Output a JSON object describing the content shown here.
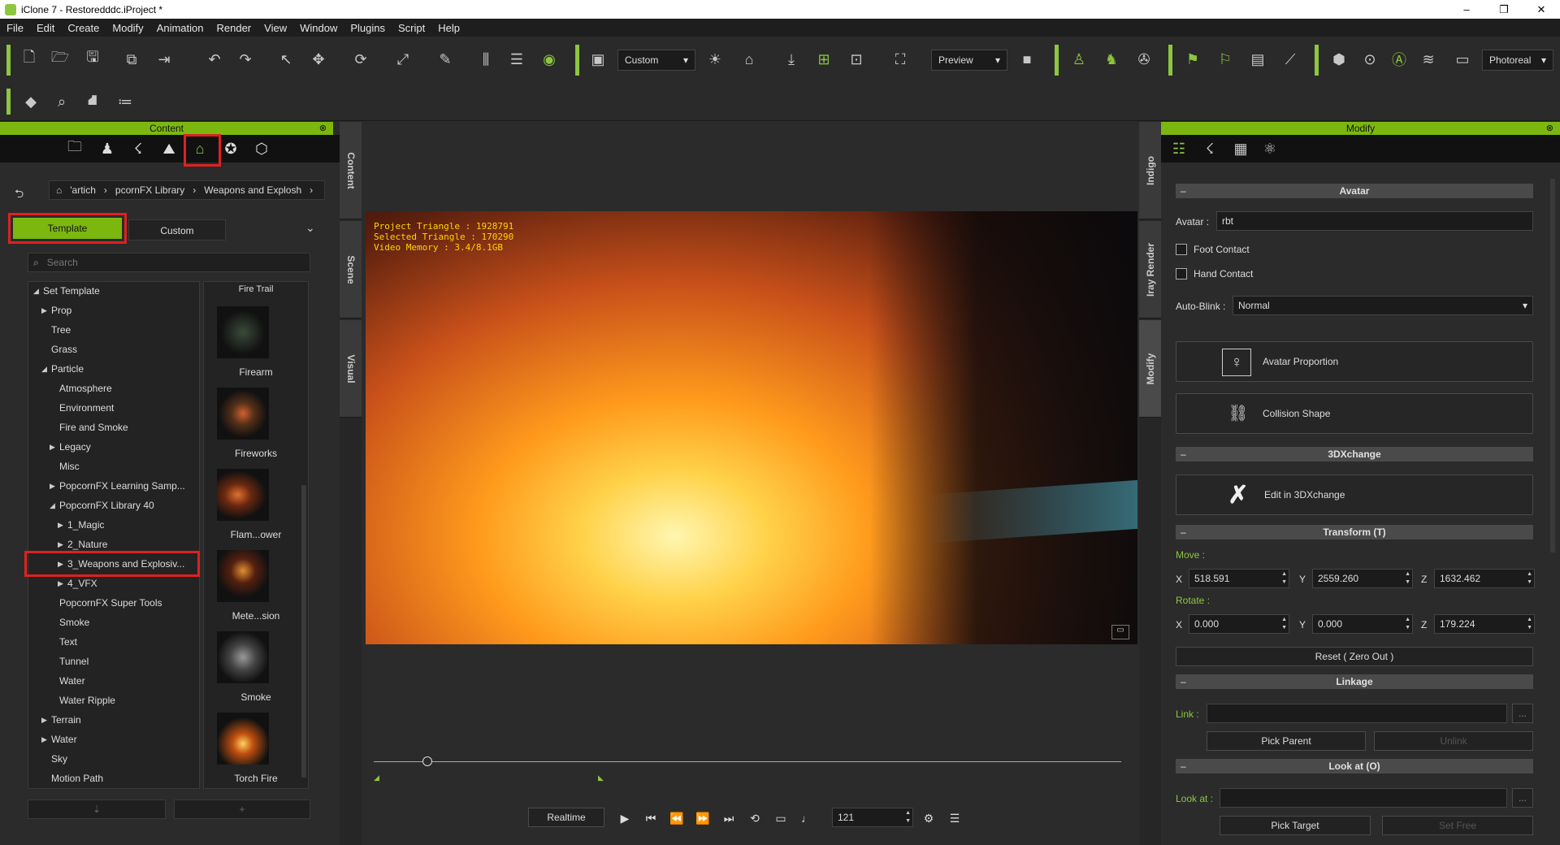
{
  "window": {
    "title": "iClone 7 - Restoredddc.iProject *",
    "minimize": "–",
    "maximize": "❐",
    "close": "✕"
  },
  "menu": [
    "File",
    "Edit",
    "Create",
    "Modify",
    "Animation",
    "Render",
    "View",
    "Window",
    "Plugins",
    "Script",
    "Help"
  ],
  "toolbar": {
    "custom_dropdown": "Custom",
    "preview_dropdown": "Preview",
    "render_dropdown": "Photoreal"
  },
  "content_panel": {
    "title": "Content",
    "breadcrumb": [
      "'artich",
      "pcornFX Library",
      "Weapons and Explosh"
    ],
    "tabs": {
      "template": "Template",
      "custom": "Custom"
    },
    "search_placeholder": "Search",
    "tree": [
      {
        "label": "Set Template",
        "indent": 0,
        "arrow": "down"
      },
      {
        "label": "Prop",
        "indent": 1,
        "arrow": "right"
      },
      {
        "label": "Tree",
        "indent": 1,
        "arrow": ""
      },
      {
        "label": "Grass",
        "indent": 1,
        "arrow": ""
      },
      {
        "label": "Particle",
        "indent": 1,
        "arrow": "down"
      },
      {
        "label": "Atmosphere",
        "indent": 2,
        "arrow": ""
      },
      {
        "label": "Environment",
        "indent": 2,
        "arrow": ""
      },
      {
        "label": "Fire and Smoke",
        "indent": 2,
        "arrow": ""
      },
      {
        "label": "Legacy",
        "indent": 2,
        "arrow": "right"
      },
      {
        "label": "Misc",
        "indent": 2,
        "arrow": ""
      },
      {
        "label": "PopcornFX Learning Samp...",
        "indent": 2,
        "arrow": "right"
      },
      {
        "label": "PopcornFX Library 40",
        "indent": 2,
        "arrow": "down"
      },
      {
        "label": "1_Magic",
        "indent": 3,
        "arrow": "right"
      },
      {
        "label": "2_Nature",
        "indent": 3,
        "arrow": "right"
      },
      {
        "label": "3_Weapons and Explosiv...",
        "indent": 3,
        "arrow": "right"
      },
      {
        "label": "4_VFX",
        "indent": 3,
        "arrow": "right"
      },
      {
        "label": "PopcornFX Super Tools",
        "indent": 2,
        "arrow": ""
      },
      {
        "label": "Smoke",
        "indent": 2,
        "arrow": ""
      },
      {
        "label": "Text",
        "indent": 2,
        "arrow": ""
      },
      {
        "label": "Tunnel",
        "indent": 2,
        "arrow": ""
      },
      {
        "label": "Water",
        "indent": 2,
        "arrow": ""
      },
      {
        "label": "Water Ripple",
        "indent": 2,
        "arrow": ""
      },
      {
        "label": "Terrain",
        "indent": 1,
        "arrow": "right"
      },
      {
        "label": "Water",
        "indent": 1,
        "arrow": "right"
      },
      {
        "label": "Sky",
        "indent": 1,
        "arrow": ""
      },
      {
        "label": "Motion Path",
        "indent": 1,
        "arrow": ""
      }
    ],
    "top_cut_label": "Fire Trail",
    "thumbnails": [
      "Firearm",
      "Fireworks",
      "Flam...ower",
      "Mete...sion",
      "Smoke",
      "Torch Fire"
    ],
    "bottom_buttons": {
      "down": "⇣",
      "add": "+"
    }
  },
  "side_tabs_left": [
    "Content",
    "Scene",
    "Visual"
  ],
  "side_tabs_right": [
    "Indigo",
    "Iray Render",
    "Modify"
  ],
  "viewport": {
    "stat_line1": "Project Triangle : 1928791",
    "stat_line2": "Selected Triangle : 170290",
    "stat_line3": "Video Memory : 3.4/8.1GB"
  },
  "playback": {
    "mode": "Realtime",
    "frame": "121"
  },
  "modify_panel": {
    "title": "Modify",
    "avatar_section": "Avatar",
    "avatar_label": "Avatar :",
    "avatar_value": "rbt",
    "foot_contact": "Foot Contact",
    "hand_contact": "Hand Contact",
    "auto_blink_label": "Auto-Blink :",
    "auto_blink_value": "Normal",
    "avatar_proportion": "Avatar Proportion",
    "collision_shape": "Collision Shape",
    "xchange_section": "3DXchange",
    "edit_3dx": "Edit in 3DXchange",
    "transform_section": "Transform  (T)",
    "move_label": "Move :",
    "rotate_label": "Rotate :",
    "move": {
      "x": "518.591",
      "y": "2559.260",
      "z": "1632.462"
    },
    "rotate": {
      "x": "0.000",
      "y": "0.000",
      "z": "179.224"
    },
    "axis_x": "X",
    "axis_y": "Y",
    "axis_z": "Z",
    "reset": "Reset ( Zero Out )",
    "linkage_section": "Linkage",
    "link_label": "Link :",
    "pick_parent": "Pick Parent",
    "unlink": "Unlink",
    "lookat_section": "Look at  (O)",
    "lookat_label": "Look at :",
    "pick_target": "Pick Target",
    "set_free": "Set Free",
    "ellipsis": "..."
  },
  "colors": {
    "accent": "#8dc63f",
    "highlight": "#e02020"
  }
}
